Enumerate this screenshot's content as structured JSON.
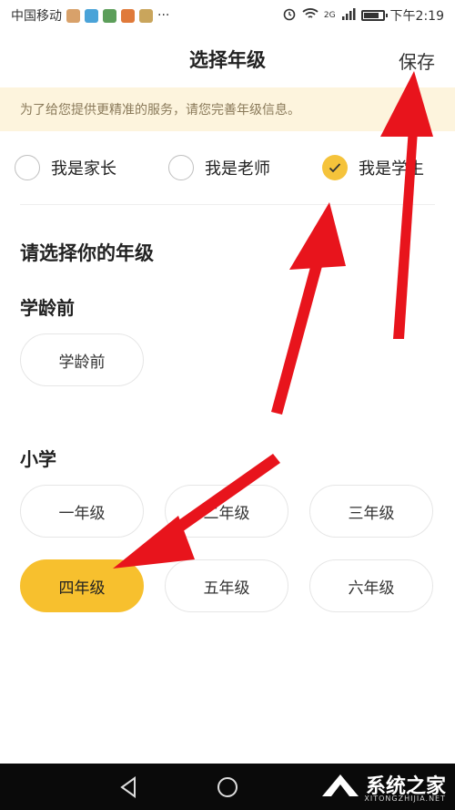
{
  "status": {
    "carrier": "中国移动",
    "dots": "···",
    "time": "下午2:19",
    "network": "2G",
    "icons": [
      "alarm-icon",
      "wifi-icon",
      "signal-icon",
      "battery-icon"
    ]
  },
  "header": {
    "title": "选择年级",
    "save_label": "保存"
  },
  "notice": {
    "text": "为了给您提供更精准的服务，请您完善年级信息。"
  },
  "roles": [
    {
      "label": "我是家长",
      "checked": false
    },
    {
      "label": "我是老师",
      "checked": false
    },
    {
      "label": "我是学生",
      "checked": true
    }
  ],
  "grade_prompt": "请选择你的年级",
  "sections": {
    "preschool": {
      "title": "学龄前",
      "grades": [
        {
          "label": "学龄前",
          "selected": false
        }
      ]
    },
    "primary": {
      "title": "小学",
      "grades": [
        {
          "label": "一年级",
          "selected": false
        },
        {
          "label": "二年级",
          "selected": false
        },
        {
          "label": "三年级",
          "selected": false
        },
        {
          "label": "四年级",
          "selected": true
        },
        {
          "label": "五年级",
          "selected": false
        },
        {
          "label": "六年级",
          "selected": false
        }
      ]
    }
  },
  "colors": {
    "accent": "#f7c02e",
    "notice_bg": "#fdf4dd",
    "annotation_arrow": "#e8141c"
  },
  "watermark": {
    "text": "系统之家",
    "sub": "XITONGZHIJIA.NET"
  }
}
